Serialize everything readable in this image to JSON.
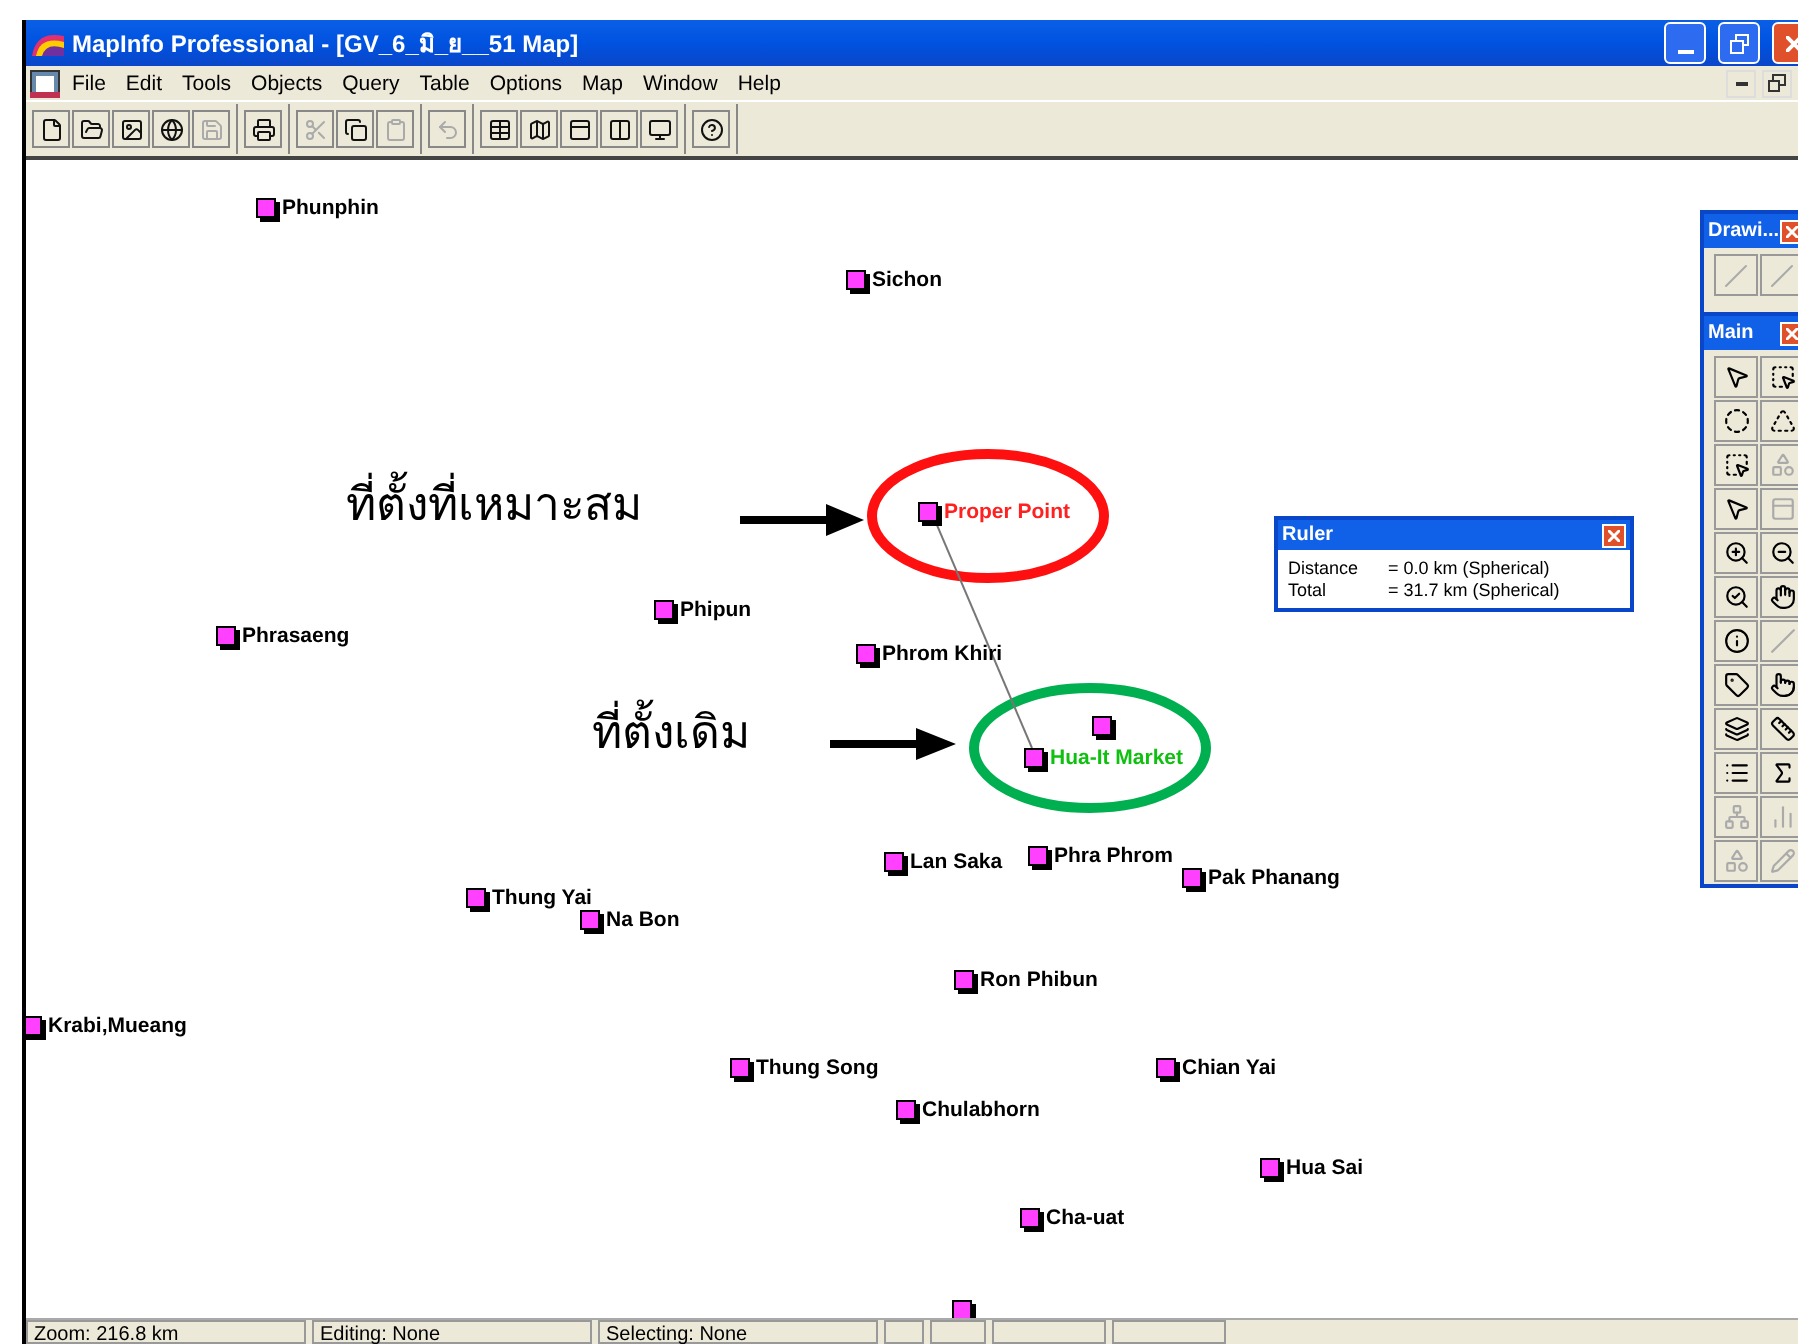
{
  "window": {
    "title": "MapInfo Professional - [GV_6_มิ_ย__51 Map]"
  },
  "menu": [
    "File",
    "Edit",
    "Tools",
    "Objects",
    "Query",
    "Table",
    "Options",
    "Map",
    "Window",
    "Help"
  ],
  "map": {
    "points": [
      {
        "kind": "place",
        "label": "Phunphin",
        "color": "#000000"
      },
      {
        "kind": "place",
        "label": "Sichon",
        "color": "#000000"
      },
      {
        "kind": "place",
        "label": "Proper Point",
        "color": "#ff2020"
      },
      {
        "kind": "place",
        "label": "Phipun",
        "color": "#000000"
      },
      {
        "kind": "place",
        "label": "Phrasaeng",
        "color": "#000000"
      },
      {
        "kind": "place",
        "label": "Phrom Khiri",
        "color": "#000000"
      },
      {
        "kind": "place",
        "label": "Hua-It Market",
        "color": "#10c010"
      },
      {
        "kind": "marker"
      },
      {
        "kind": "place",
        "label": "Lan Saka",
        "color": "#000000"
      },
      {
        "kind": "place",
        "label": "Phra Phrom",
        "color": "#000000"
      },
      {
        "kind": "place",
        "label": "Pak Phanang",
        "color": "#000000"
      },
      {
        "kind": "place",
        "label": "Thung Yai",
        "color": "#000000"
      },
      {
        "kind": "place",
        "label": "Na Bon",
        "color": "#000000"
      },
      {
        "kind": "place",
        "label": "Ron Phibun",
        "color": "#000000"
      },
      {
        "kind": "place",
        "label": "Krabi,Mueang",
        "color": "#000000"
      },
      {
        "kind": "place",
        "label": "Thung Song",
        "color": "#000000"
      },
      {
        "kind": "place",
        "label": "Chian Yai",
        "color": "#000000"
      },
      {
        "kind": "place",
        "label": "Chulabhorn",
        "color": "#000000"
      },
      {
        "kind": "place",
        "label": "Hua Sai",
        "color": "#000000"
      },
      {
        "kind": "place",
        "label": "Cha-uat",
        "color": "#000000"
      },
      {
        "kind": "marker"
      }
    ],
    "annotations": [
      "ที่ตั้งที่เหมาะสม",
      "ที่ตั้งเดิม"
    ]
  },
  "ruler": {
    "title": "Ruler",
    "rows": [
      {
        "label": "Distance",
        "value": "= 0.0 km (Spherical)"
      },
      {
        "label": "Total",
        "value": "= 31.7 km (Spherical)"
      }
    ]
  },
  "drawing_palette": {
    "title": "Drawi..."
  },
  "main_palette": {
    "title": "Main"
  },
  "status_bar": [
    "Zoom: 216.8 km",
    "Editing: None",
    "Selecting: None"
  ]
}
